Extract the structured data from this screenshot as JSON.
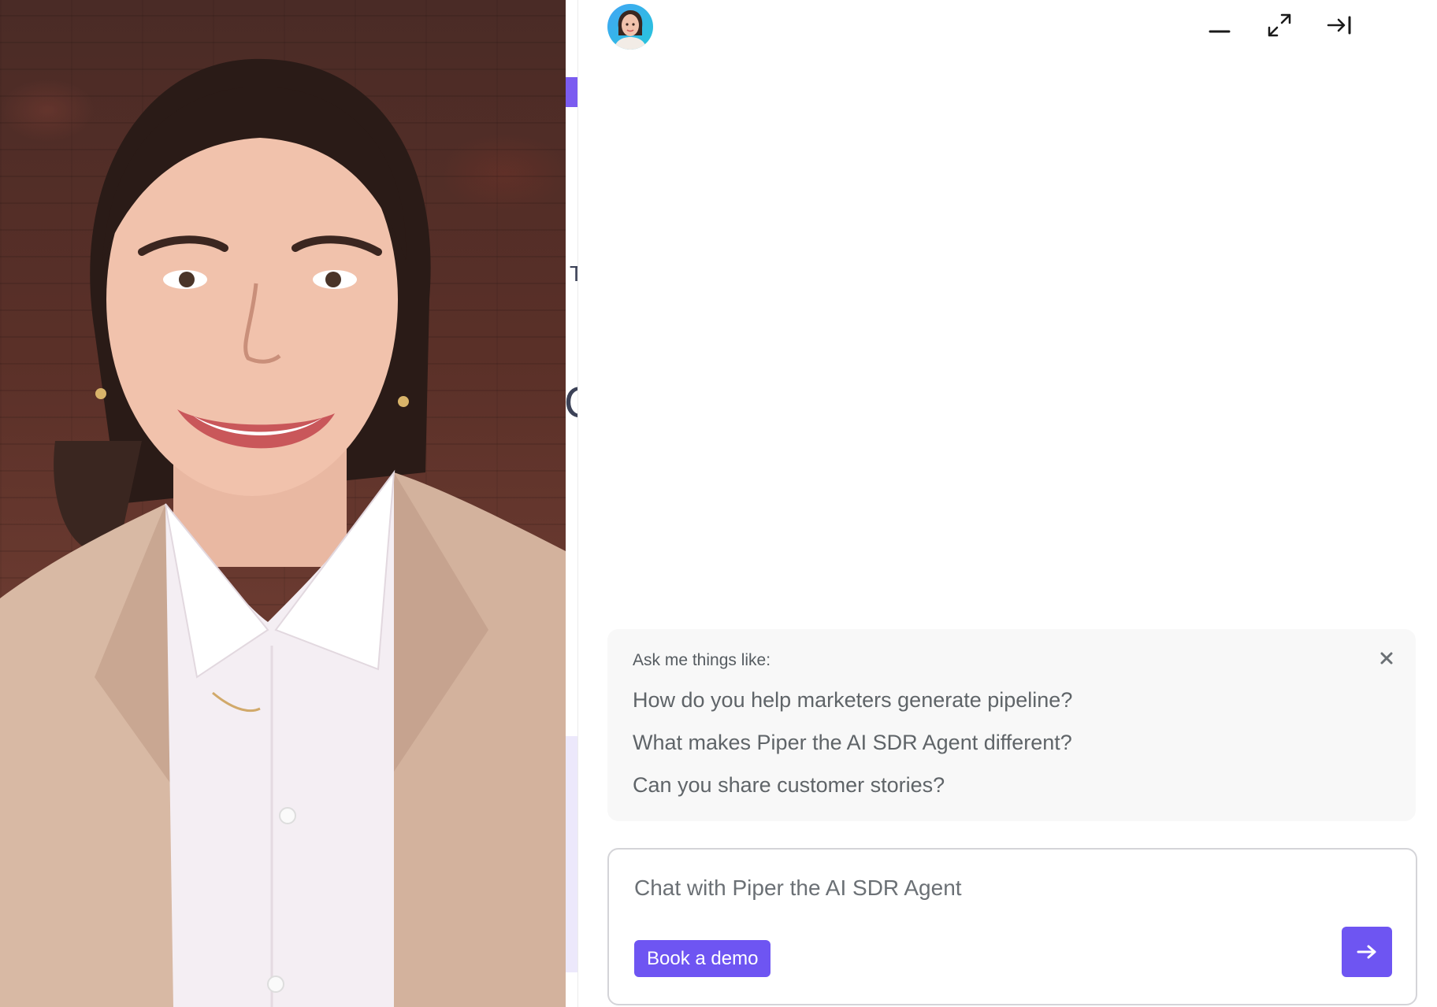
{
  "colors": {
    "accent": "#6e55f2",
    "panel_background": "#ffffff",
    "suggestion_background": "#f8f8f8",
    "text_muted": "#5f6468"
  },
  "video": {
    "subject_icon": "presenter-video"
  },
  "underlying_page": {
    "glyph_top": "T",
    "glyph_middle": "C"
  },
  "header": {
    "avatar_icon": "agent-avatar",
    "minimize_icon": "minimize-icon",
    "expand_icon": "expand-icon",
    "collapse_icon": "collapse-right-icon"
  },
  "suggestions": {
    "heading": "Ask me things like:",
    "close_icon": "close-icon",
    "items": [
      "How do you help marketers generate pipeline?",
      "What makes Piper the AI SDR Agent different?",
      "Can you share customer stories?"
    ]
  },
  "composer": {
    "placeholder": "Chat with Piper the AI SDR Agent",
    "value": "",
    "book_demo_label": "Book a demo",
    "send_icon": "arrow-right-icon"
  }
}
